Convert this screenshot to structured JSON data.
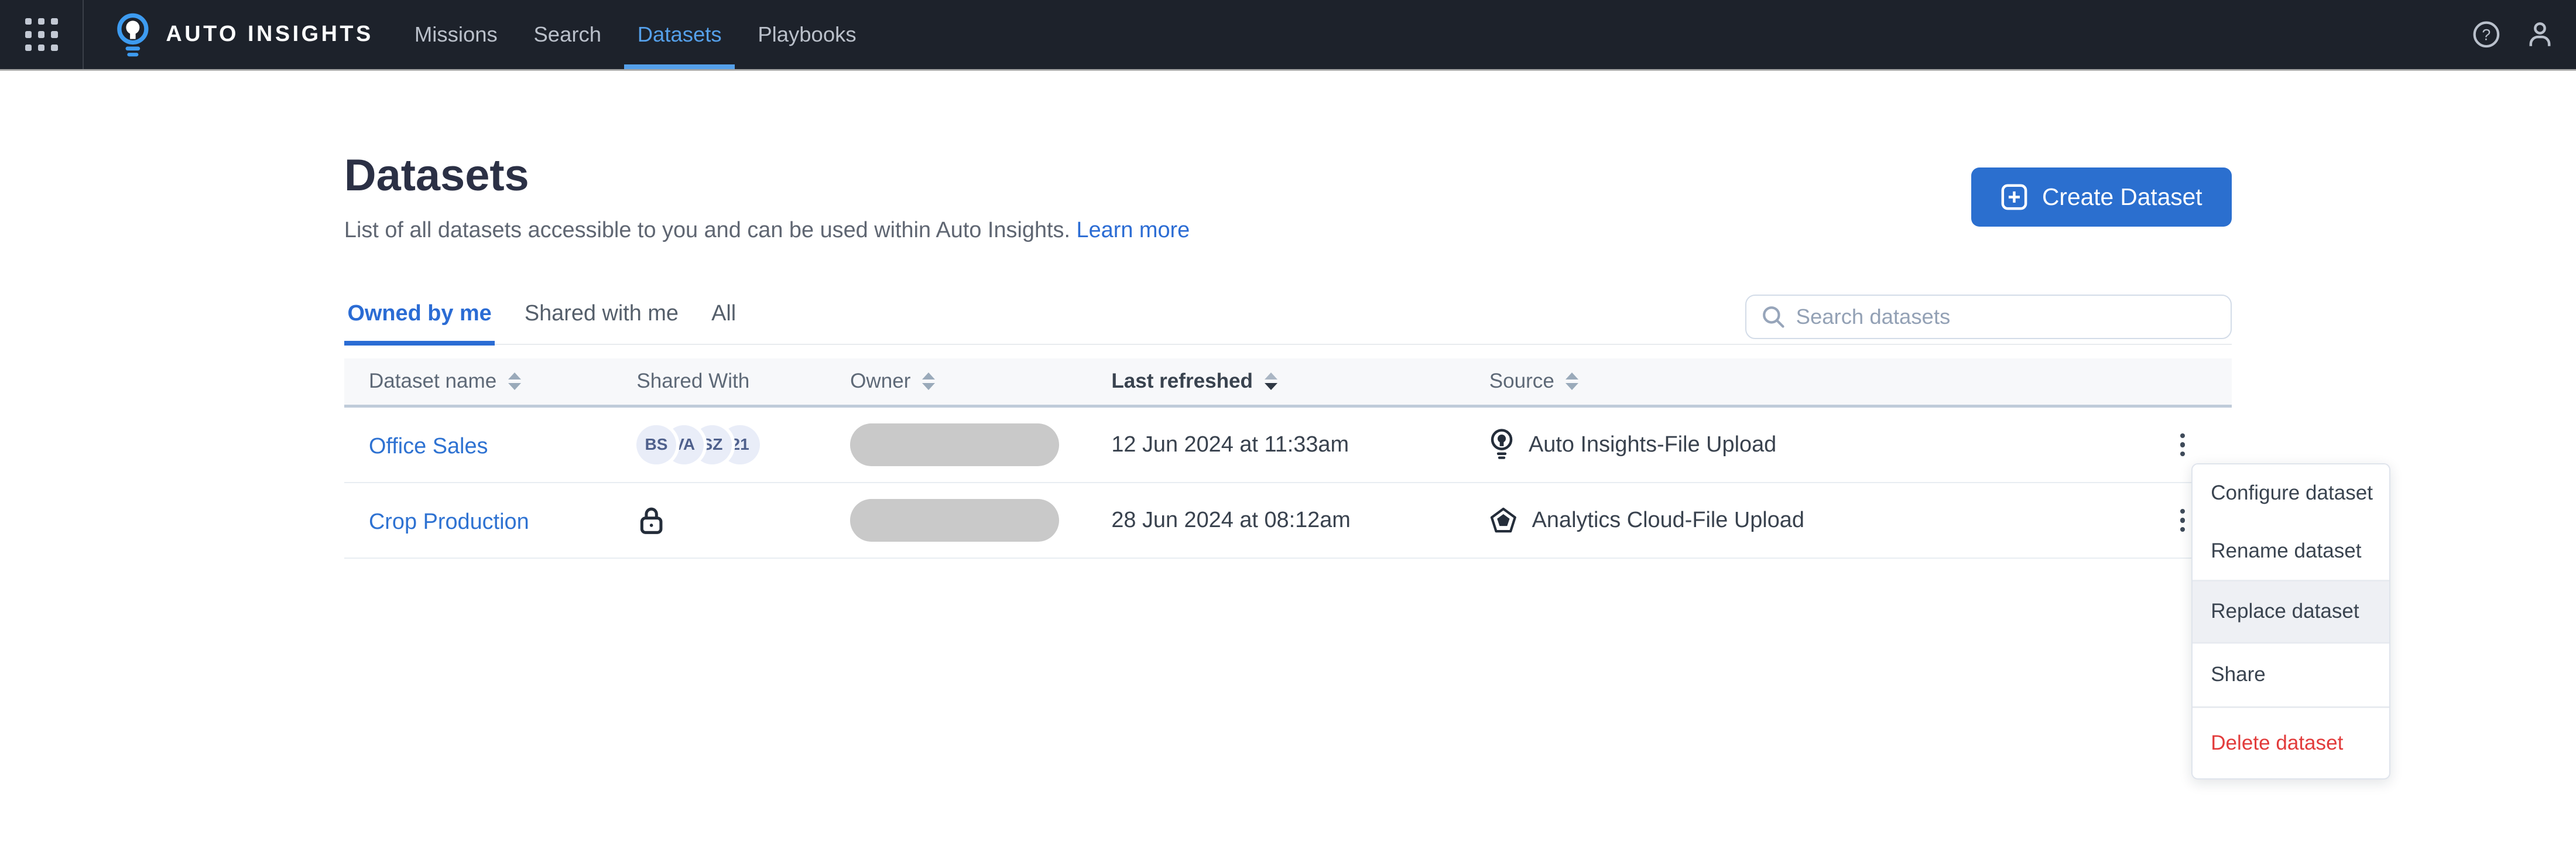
{
  "navbar": {
    "brand": "AUTO INSIGHTS",
    "items": [
      {
        "label": "Missions",
        "active": false
      },
      {
        "label": "Search",
        "active": false
      },
      {
        "label": "Datasets",
        "active": true
      },
      {
        "label": "Playbooks",
        "active": false
      }
    ]
  },
  "header": {
    "title": "Datasets",
    "subtitle": "List of all datasets accessible to you and can be used within Auto Insights.",
    "learn_more_label": "Learn more",
    "create_button_label": "Create Dataset"
  },
  "tabs": [
    {
      "label": "Owned by me",
      "active": true
    },
    {
      "label": "Shared with me",
      "active": false
    },
    {
      "label": "All",
      "active": false
    }
  ],
  "search": {
    "placeholder": "Search datasets"
  },
  "table": {
    "columns": [
      {
        "label": "Dataset name",
        "sortable": true
      },
      {
        "label": "Shared With",
        "sortable": false
      },
      {
        "label": "Owner",
        "sortable": true
      },
      {
        "label": "Last refreshed",
        "sortable": true,
        "sort_direction": "desc"
      },
      {
        "label": "Source",
        "sortable": true
      }
    ],
    "rows": [
      {
        "name": "Office Sales",
        "shared_with_avatars": [
          "BS",
          "VA",
          "SZ",
          "21"
        ],
        "owner": "redacted",
        "last_refreshed": "12 Jun 2024 at 11:33am",
        "source": "Auto Insights-File Upload",
        "source_icon": "auto-insights-lightbulb-icon"
      },
      {
        "name": "Crop Production",
        "shared_with_icon": "lock-icon",
        "owner": "redacted",
        "last_refreshed": "28 Jun 2024 at 08:12am",
        "source": "Analytics Cloud-File Upload",
        "source_icon": "analytics-cloud-pentagon-icon"
      }
    ]
  },
  "context_menu": {
    "items": [
      {
        "label": "Configure dataset",
        "state": "default"
      },
      {
        "label": "Rename dataset",
        "state": "default"
      },
      {
        "label": "Replace dataset",
        "state": "highlighted"
      },
      {
        "label": "Share",
        "state": "default"
      },
      {
        "label": "Delete dataset",
        "state": "danger"
      }
    ]
  },
  "colors": {
    "navbar_bg": "#1d222b",
    "accent_blue": "#2b6fcf",
    "link_blue": "#2e72d2",
    "active_tab_blue": "#2b6cd4",
    "nav_active_blue": "#55a0ea",
    "danger_red": "#e23b3b",
    "table_header_bg": "#f7f8fa",
    "avatar_bg": "#e9edf8",
    "owner_redacted_gray": "#c9c9c9"
  }
}
